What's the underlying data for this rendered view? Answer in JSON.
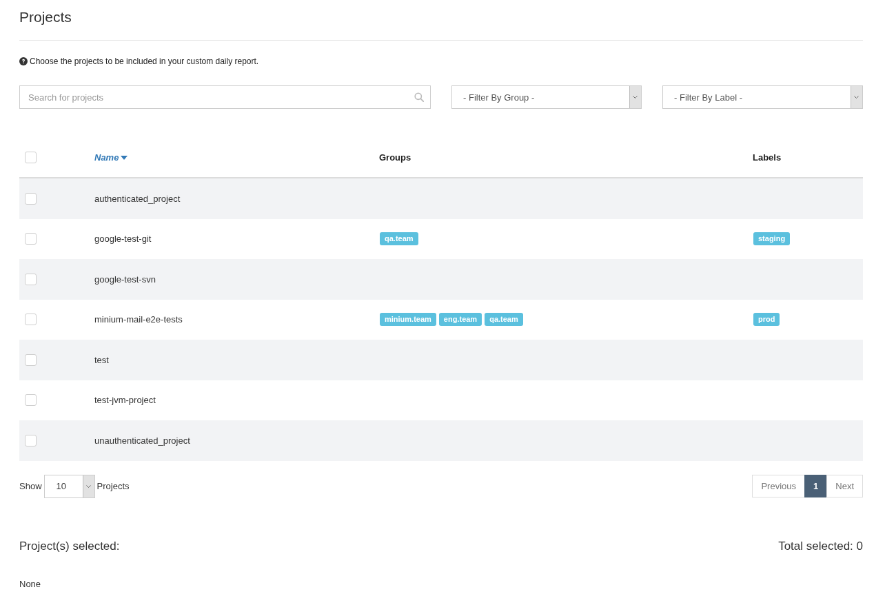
{
  "page": {
    "title": "Projects"
  },
  "info": "Choose the projects to be included in your custom daily report.",
  "search": {
    "placeholder": "Search for projects"
  },
  "filters": [
    {
      "value": "- Filter By Group -"
    },
    {
      "value": "- Filter By Label -"
    }
  ],
  "table": {
    "select_all": {
      "checked": false
    },
    "columns": [
      {
        "label": "Name",
        "sorted": true
      },
      {
        "label": "Groups",
        "sorted": false
      },
      {
        "label": "Labels",
        "sorted": false
      }
    ],
    "rows": [
      {
        "name": "authenticated_project",
        "checked": false,
        "groups": [],
        "labels": []
      },
      {
        "name": "google-test-git",
        "checked": false,
        "groups": [
          "qa.team"
        ],
        "labels": [
          "staging"
        ]
      },
      {
        "name": "google-test-svn",
        "checked": false,
        "groups": [],
        "labels": []
      },
      {
        "name": "minium-mail-e2e-tests",
        "checked": false,
        "groups": [
          "minium.team",
          "eng.team",
          "qa.team"
        ],
        "labels": [
          "prod"
        ]
      },
      {
        "name": "test",
        "checked": false,
        "groups": [],
        "labels": []
      },
      {
        "name": "test-jvm-project",
        "checked": false,
        "groups": [],
        "labels": []
      },
      {
        "name": "unauthenticated_project",
        "checked": false,
        "groups": [],
        "labels": []
      }
    ]
  },
  "page_size": {
    "label_before": "Show",
    "value": "10",
    "label_after": "Projects"
  },
  "pagination": [
    {
      "label": "Previous",
      "selected": false
    },
    {
      "label": "1",
      "selected": true
    },
    {
      "label": "Next",
      "selected": false
    }
  ],
  "selection": {
    "title": "Project(s) selected:",
    "total": "Total selected: 0",
    "empty_text": "None"
  }
}
